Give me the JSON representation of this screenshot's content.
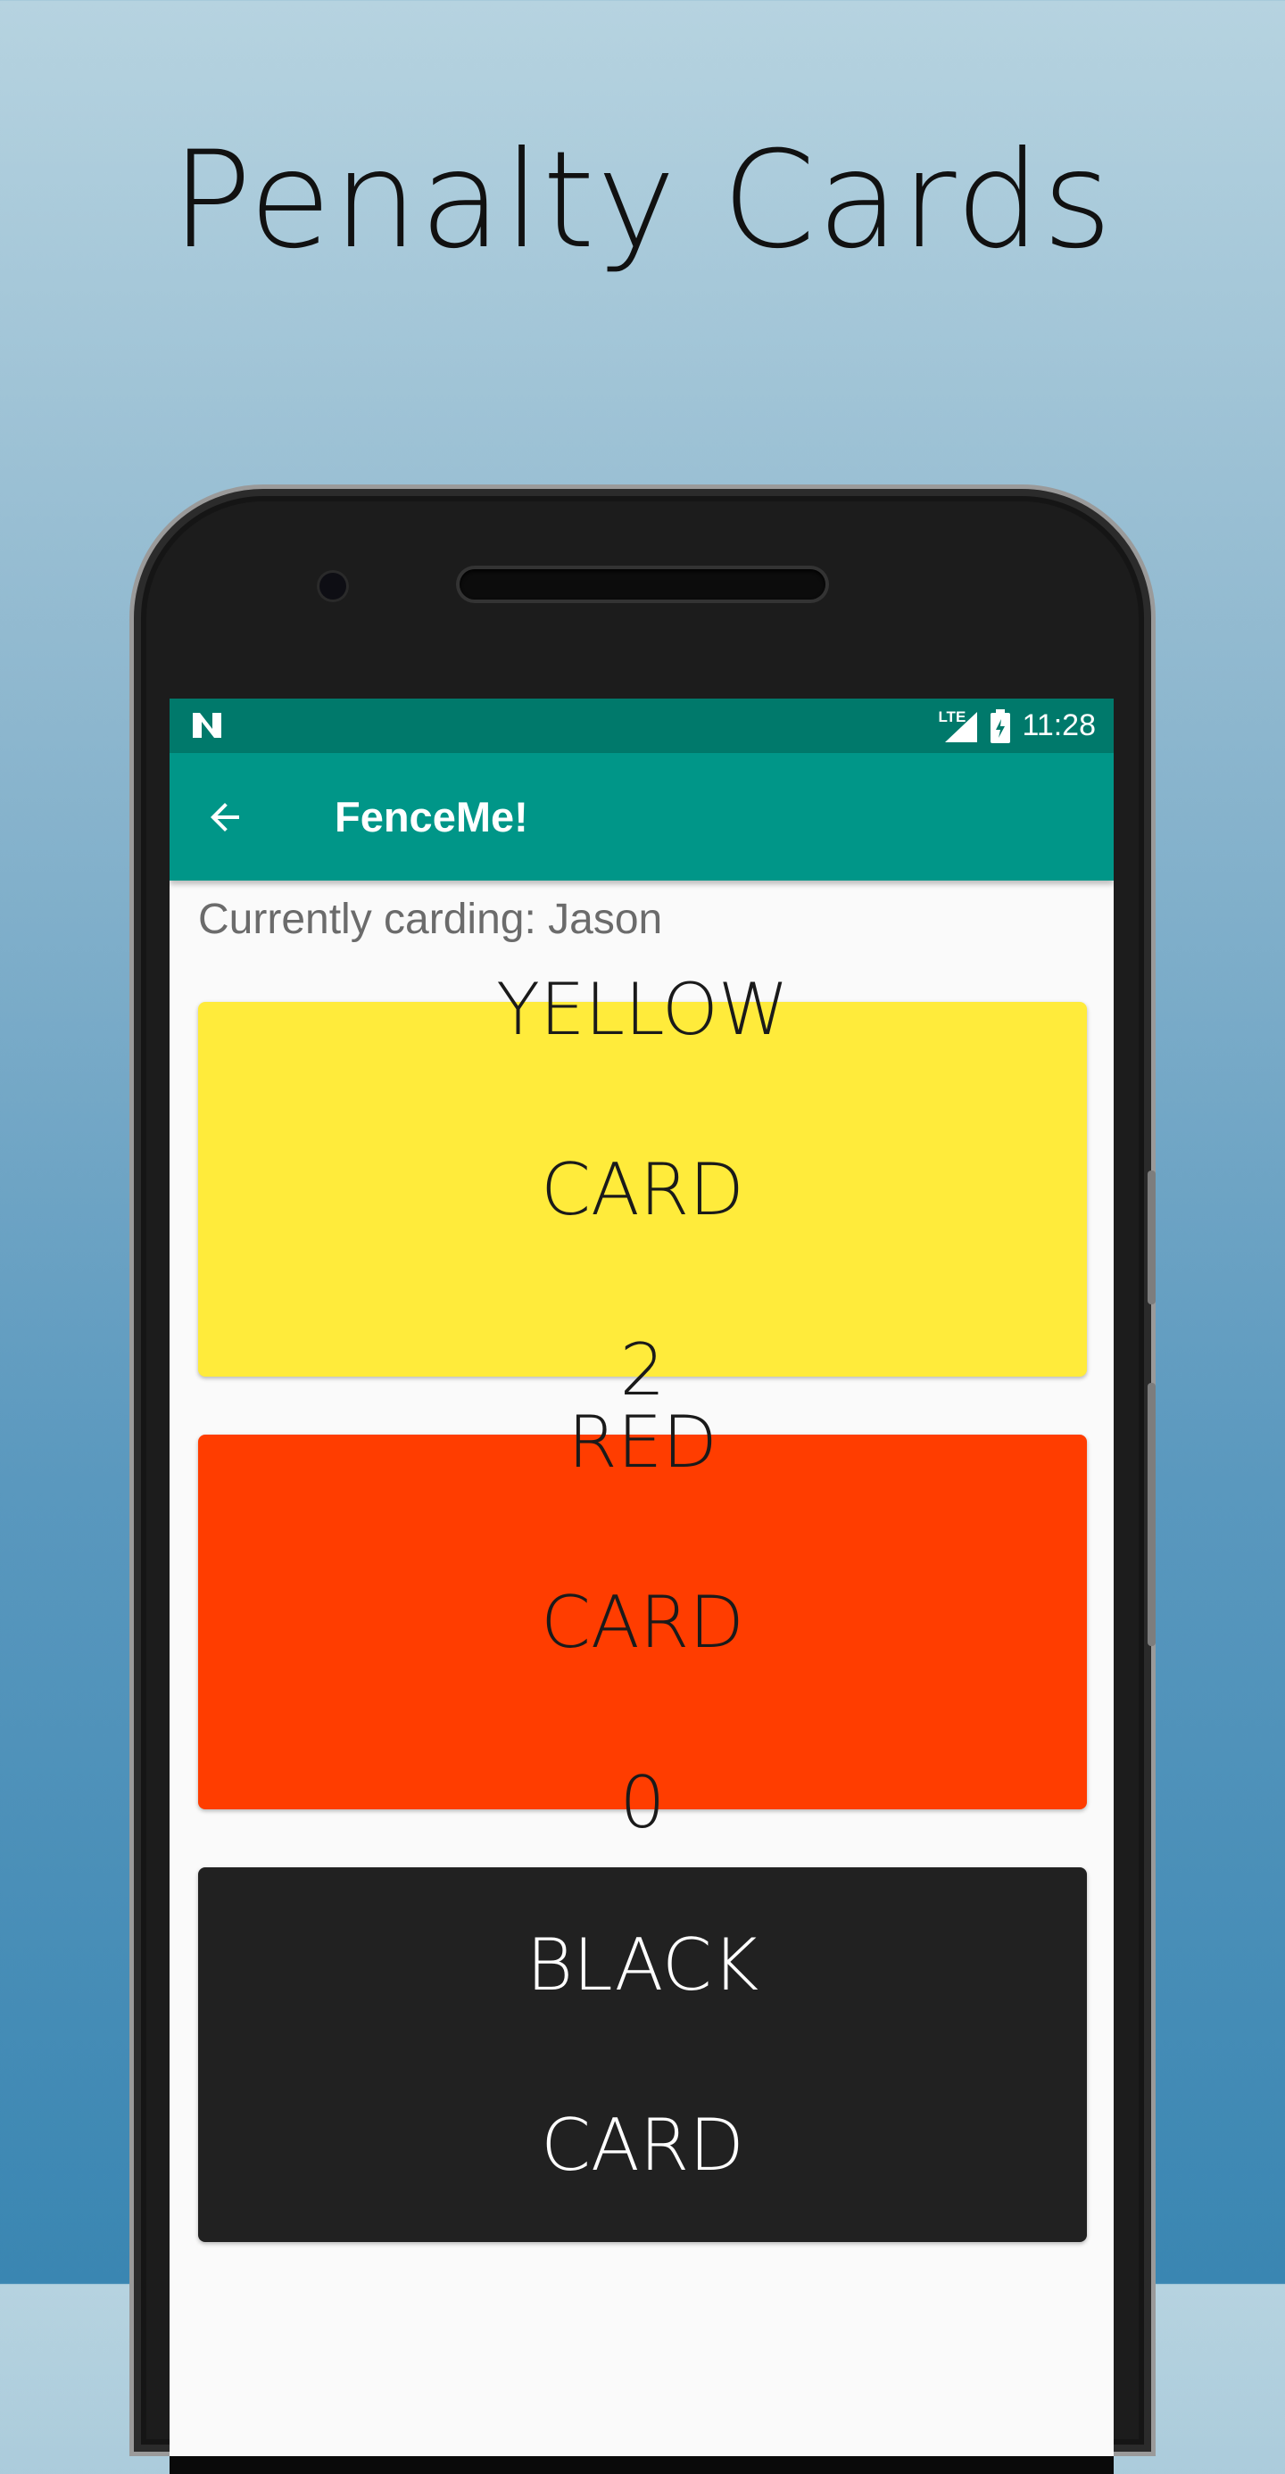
{
  "promo": {
    "title": "Penalty Cards"
  },
  "statusbar": {
    "time": "11:28",
    "network_label": "LTE",
    "notification_icon": "n-icon",
    "color": "#00796b"
  },
  "appbar": {
    "title": "FenceMe!",
    "color": "#009688"
  },
  "content": {
    "carding_label": "Currently carding: Jason",
    "cards": [
      {
        "line1": "YELLOW",
        "line2": "CARD",
        "count": "2",
        "color": "#ffeb3b"
      },
      {
        "line1": "RED",
        "line2": "CARD",
        "count": "0",
        "color": "#ff3d00"
      },
      {
        "line1": "BLACK",
        "line2": "CARD",
        "count": "",
        "color": "#212121"
      }
    ]
  }
}
